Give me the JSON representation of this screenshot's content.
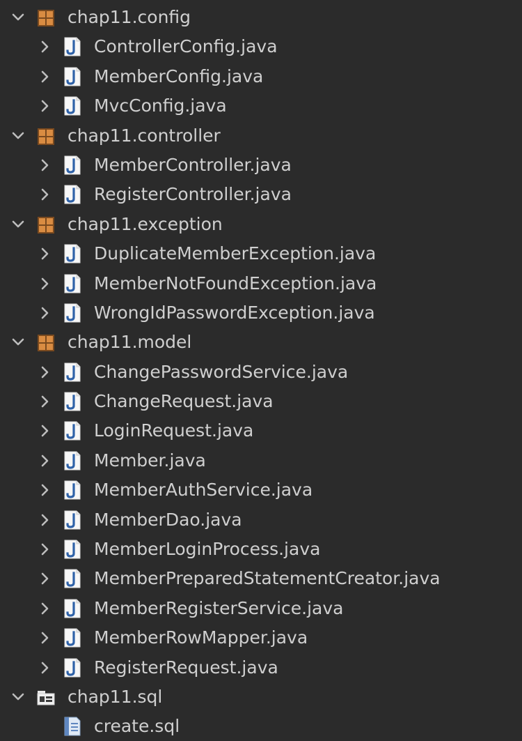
{
  "tree": [
    {
      "label": "chap11.config",
      "kind": "package",
      "expanded": true,
      "icon": "package-icon"
    },
    {
      "label": "ControllerConfig.java",
      "kind": "java",
      "expanded": false,
      "icon": "java-file-icon"
    },
    {
      "label": "MemberConfig.java",
      "kind": "java",
      "expanded": false,
      "icon": "java-file-icon"
    },
    {
      "label": "MvcConfig.java",
      "kind": "java",
      "expanded": false,
      "icon": "java-file-icon"
    },
    {
      "label": "chap11.controller",
      "kind": "package",
      "expanded": true,
      "icon": "package-icon"
    },
    {
      "label": "MemberController.java",
      "kind": "java",
      "expanded": false,
      "icon": "java-file-icon"
    },
    {
      "label": "RegisterController.java",
      "kind": "java",
      "expanded": false,
      "icon": "java-file-icon"
    },
    {
      "label": "chap11.exception",
      "kind": "package",
      "expanded": true,
      "icon": "package-icon"
    },
    {
      "label": "DuplicateMemberException.java",
      "kind": "java",
      "expanded": false,
      "icon": "java-file-icon"
    },
    {
      "label": "MemberNotFoundException.java",
      "kind": "java",
      "expanded": false,
      "icon": "java-file-icon"
    },
    {
      "label": "WrongIdPasswordException.java",
      "kind": "java",
      "expanded": false,
      "icon": "java-file-icon"
    },
    {
      "label": "chap11.model",
      "kind": "package",
      "expanded": true,
      "icon": "package-icon"
    },
    {
      "label": "ChangePasswordService.java",
      "kind": "java",
      "expanded": false,
      "icon": "java-file-icon"
    },
    {
      "label": "ChangeRequest.java",
      "kind": "java",
      "expanded": false,
      "icon": "java-file-icon"
    },
    {
      "label": "LoginRequest.java",
      "kind": "java",
      "expanded": false,
      "icon": "java-file-icon"
    },
    {
      "label": "Member.java",
      "kind": "java",
      "expanded": false,
      "icon": "java-file-icon"
    },
    {
      "label": "MemberAuthService.java",
      "kind": "java",
      "expanded": false,
      "icon": "java-file-icon"
    },
    {
      "label": "MemberDao.java",
      "kind": "java",
      "expanded": false,
      "icon": "java-file-icon"
    },
    {
      "label": "MemberLoginProcess.java",
      "kind": "java",
      "expanded": false,
      "icon": "java-file-icon"
    },
    {
      "label": "MemberPreparedStatementCreator.java",
      "kind": "java",
      "expanded": false,
      "icon": "java-file-icon"
    },
    {
      "label": "MemberRegisterService.java",
      "kind": "java",
      "expanded": false,
      "icon": "java-file-icon"
    },
    {
      "label": "MemberRowMapper.java",
      "kind": "java",
      "expanded": false,
      "icon": "java-file-icon"
    },
    {
      "label": "RegisterRequest.java",
      "kind": "java",
      "expanded": false,
      "icon": "java-file-icon"
    },
    {
      "label": "chap11.sql",
      "kind": "folder",
      "expanded": true,
      "icon": "resource-folder-icon"
    },
    {
      "label": "create.sql",
      "kind": "sql",
      "expanded": null,
      "icon": "sql-file-icon"
    }
  ],
  "colors": {
    "background": "#2b2b2b",
    "text": "#cfcfcf",
    "chevron": "#bdbdbd",
    "package_orange": "#c07a3a",
    "java_blue": "#2f62a8"
  }
}
